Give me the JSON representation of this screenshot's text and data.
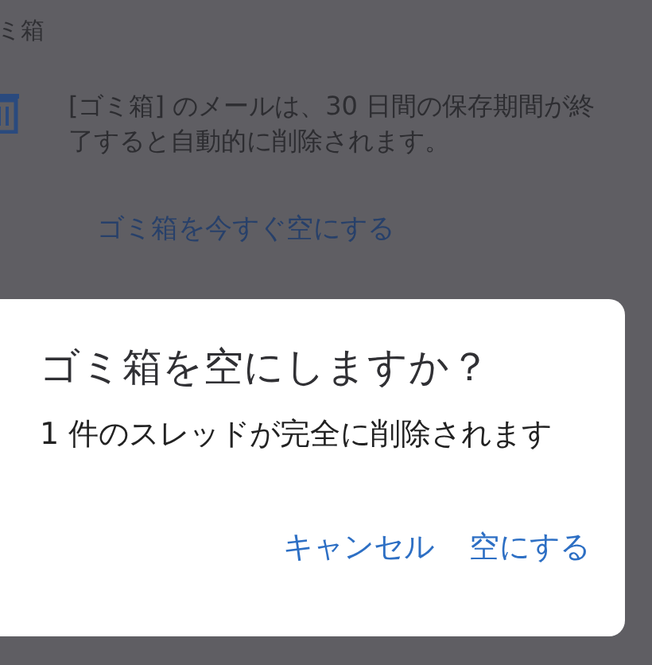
{
  "page_header": {
    "title": "ミ箱"
  },
  "trash_info": {
    "message": "[ゴミ箱] のメールは、30 日間の保存期間が終了すると自動的に削除されます。",
    "link": "ゴミ箱を今すぐ空にする"
  },
  "dialog": {
    "title": "ゴミ箱を空にしますか？",
    "body": "1 件のスレッドが完全に削除されます",
    "buttons": [
      "キャンセル",
      "空にする"
    ]
  }
}
